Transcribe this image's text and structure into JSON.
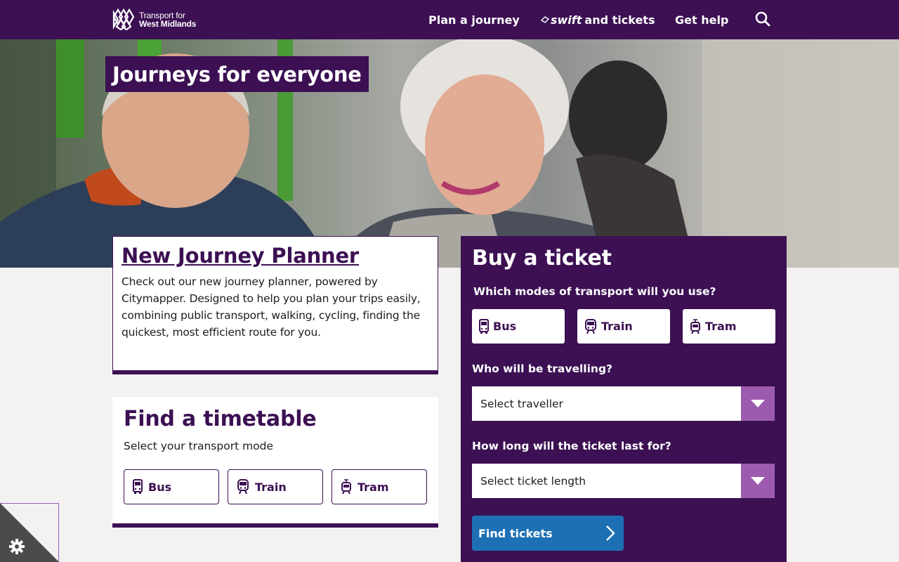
{
  "header": {
    "logo": {
      "line1": "Transport for",
      "line2": "West Midlands"
    },
    "nav": {
      "plan": "Plan a journey",
      "swift_brand": "swift",
      "swift_rest": "and tickets",
      "help": "Get help"
    },
    "icons": [
      "wmca-logo-icon",
      "swift-icon",
      "search-icon"
    ]
  },
  "hero": {
    "title": "Journeys for everyone"
  },
  "journey_planner": {
    "title": "New Journey Planner",
    "body": "Check out our new journey planner, powered by Citymapper. Designed to help you plan your trips easily, combining public transport, walking, cycling, finding the quickest, most efficient route for you."
  },
  "timetable": {
    "title": "Find a timetable",
    "subtitle": "Select your transport mode",
    "modes": [
      "Bus",
      "Train",
      "Tram"
    ]
  },
  "ticket": {
    "title": "Buy a ticket",
    "q_modes": "Which modes of transport will you use?",
    "modes": [
      "Bus",
      "Train",
      "Tram"
    ],
    "q_traveller": "Who will be travelling?",
    "traveller_value": "Select traveller",
    "q_length": "How long will the ticket last for?",
    "length_value": "Select ticket length",
    "find_label": "Find tickets"
  },
  "colors": {
    "brand_purple": "#3c1053",
    "accent_lilac": "#9d5baf",
    "button_blue": "#1e70b4",
    "page_bg": "#f3f2f1"
  }
}
